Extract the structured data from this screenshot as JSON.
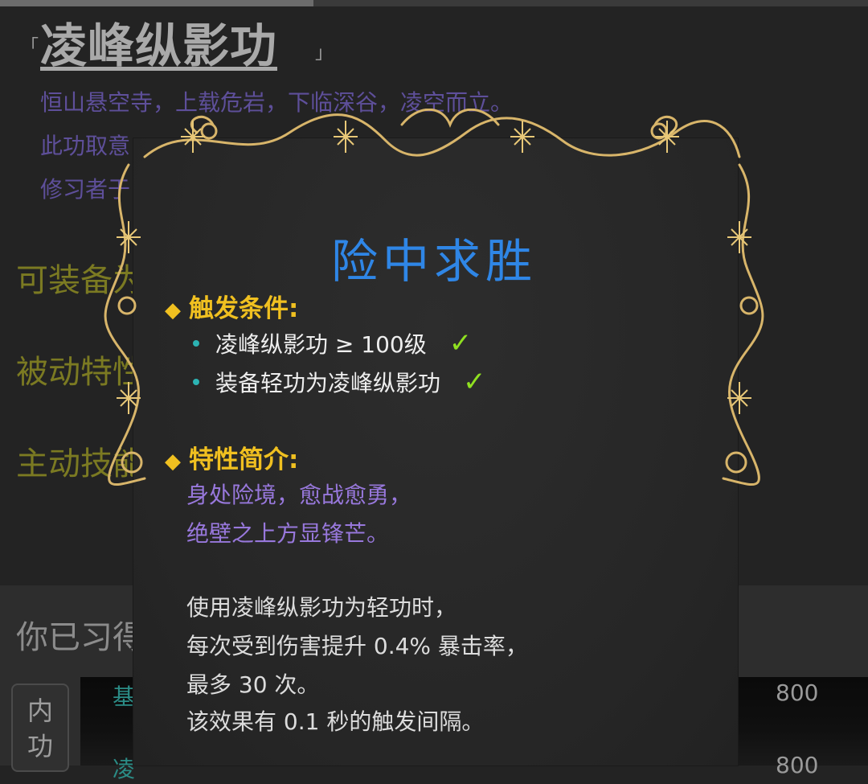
{
  "page": {
    "title": "凌峰纵影功",
    "bracket_open": "「",
    "bracket_close": "」",
    "description": [
      "恒山悬空寺，上载危岩，下临深谷，凌空而立。",
      "此功取意",
      "修习者于"
    ],
    "sections": [
      "可装备为",
      "被动特性",
      "主动技能"
    ],
    "learned_text": "你已习得",
    "tab_label": [
      "内",
      "功"
    ],
    "rows": [
      {
        "label": "基",
        "value": "800"
      },
      {
        "label": "凌",
        "value": "800"
      }
    ]
  },
  "popup": {
    "title": "险中求胜",
    "trigger_heading": "触发条件:",
    "conditions": [
      {
        "text": "凌峰纵影功 ≥ 100级",
        "check": "✓"
      },
      {
        "text": "装备轻功为凌峰纵影功",
        "check": "✓"
      }
    ],
    "intro_heading": "特性简介:",
    "flavor": [
      "身处险境，愈战愈勇，",
      "绝壁之上方显锋芒。"
    ],
    "effect": [
      "使用凌峰纵影功为轻功时，",
      "每次受到伤害提升 0.4% 暴击率，",
      "最多 30 次。",
      "该效果有 0.1 秒的触发间隔。"
    ],
    "diamond": "◆"
  },
  "colors": {
    "title_blue": "#2f86e6",
    "heading_gold": "#f0c020",
    "check_green": "#8fe020",
    "flavor_purple": "#9878dc",
    "section_olive": "#7b7a22",
    "frame_gold": "#d8b56a"
  }
}
